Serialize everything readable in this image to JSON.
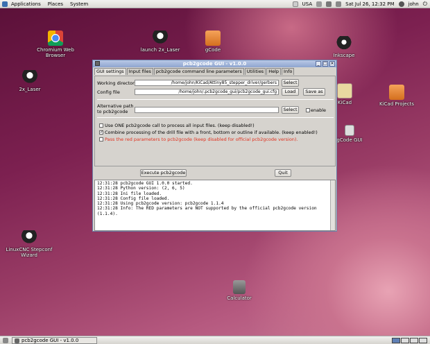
{
  "top_panel": {
    "menus": [
      "Applications",
      "Places",
      "System"
    ],
    "keyboard": "USA",
    "clock": "Sat Jul 26, 12:32 PM",
    "user": "john"
  },
  "desktop_icons": {
    "chromium": "Chromium Web Browser",
    "launch2x": "launch 2x_Laser",
    "gcode": "gCode",
    "inkscape": "Inkscape",
    "laser2x": "2x_Laser",
    "kicad": "KiCad",
    "kicad_projects": "KiCad Projects",
    "gcode_gui": "gCode GUI",
    "linuxcnc": "LinuxCNC Stepconf Wizard",
    "calculator": "Calculator"
  },
  "window": {
    "title": "pcb2gcode GUI - v1.0.0",
    "tabs": [
      "GUI settings",
      "Input files",
      "pcb2gcode command line parameters",
      "Utilities",
      "Help",
      "Info"
    ],
    "working_dir_label": "Working directory",
    "working_dir_value": "/home/john/KiCad/Attiny85_stepper_driver/gerbers",
    "config_label": "Config file",
    "config_value": "/home/john/.pcb2gcode_gui/pcb2gcode_gui.cfg",
    "alt_path_label_1": "Alternative path",
    "alt_path_label_2": "to pcb2gcode",
    "alt_path_value": "",
    "select_label": "Select",
    "load_label": "Load",
    "save_as_label": "Save as",
    "enable_label": "enable",
    "opt1": "Use ONE pcb2gcode call to process all input files. (keep disabled!)",
    "opt2": "Combine processing of the drill file with a front, bottom or outline if available. (keep enabled!)",
    "opt3": "Pass the red parameters to pcb2gcode (keep disabled for official pcb2gcode version).",
    "execute_label": "Execute pcb2gcode",
    "quit_label": "Quit",
    "log": [
      "12:31:28 pcb2gcode GUI 1.0.0 started.",
      "12:31:28 Python version: (2, 6, 5)",
      "12:31:28 Ini file loaded.",
      "12:31:28 Config file loaded.",
      "12:31:28 Using pcb2gcode version: pcb2gcode 1.1.4",
      "12:31:28 Info: The RED parameters are NOT supported by the official pcb2gcode version (1.1.4)."
    ]
  },
  "taskbar": {
    "item": "pcb2gcode GUI - v1.0.0"
  },
  "colors": {
    "red_text": "#e0301e",
    "title_blue": "#8fa5cf"
  }
}
